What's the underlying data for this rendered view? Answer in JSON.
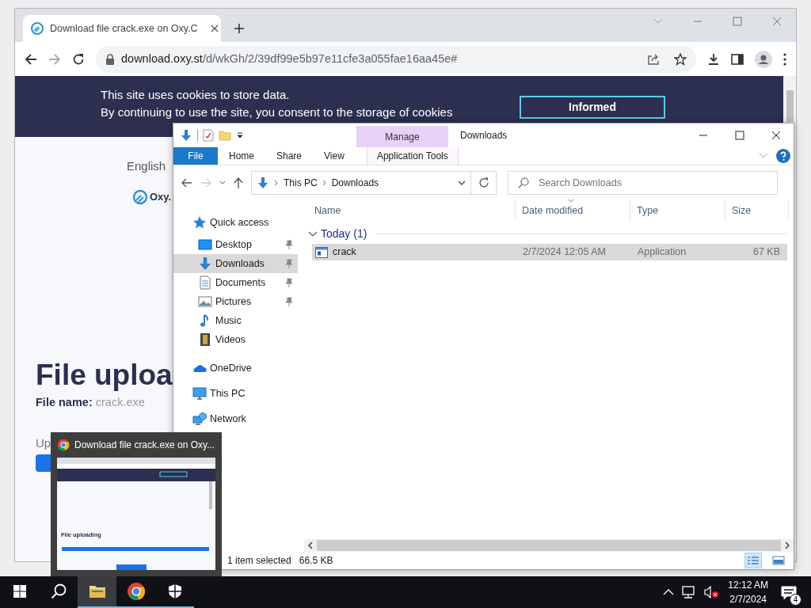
{
  "browser": {
    "tab": {
      "title": "Download file crack.exe on Oxy.C",
      "selected": true
    },
    "url": {
      "host": "download.oxy.st",
      "path": "/d/wkGh/2/39df99e5b97e11cfe3a055fae16aa45e#"
    }
  },
  "page": {
    "cookie_banner": {
      "lines": [
        "This site uses cookies to store data.",
        "By continuing to use the site, you consent to the storage of cookies"
      ],
      "button": "Informed"
    },
    "language": "English",
    "logo": "Oxy.",
    "heading": "File uploa",
    "file_label": "File name:",
    "file_name": "crack.exe",
    "progress": {
      "label": "Up"
    }
  },
  "explorer": {
    "title": "Downloads",
    "context_tab": "Manage",
    "tabs": [
      {
        "label": "File",
        "kind": "file-menu",
        "selected": false
      },
      {
        "label": "Home",
        "kind": "tab",
        "selected": false
      },
      {
        "label": "Share",
        "kind": "tab",
        "selected": false
      },
      {
        "label": "View",
        "kind": "tab",
        "selected": false
      },
      {
        "label": "Application Tools",
        "kind": "context",
        "selected": false
      }
    ],
    "address": [
      "This PC",
      "Downloads"
    ],
    "search": {
      "placeholder": "Search Downloads"
    },
    "nav": [
      {
        "label": "Quick access",
        "kind": "quick-access",
        "selected": false,
        "children": [
          {
            "label": "Desktop",
            "kind": "desktop",
            "selected": false,
            "pinned": true
          },
          {
            "label": "Downloads",
            "kind": "downloads",
            "selected": true,
            "pinned": true
          },
          {
            "label": "Documents",
            "kind": "documents",
            "selected": false,
            "pinned": true
          },
          {
            "label": "Pictures",
            "kind": "pictures",
            "selected": false,
            "pinned": true
          },
          {
            "label": "Music",
            "kind": "music",
            "selected": false,
            "pinned": false
          },
          {
            "label": "Videos",
            "kind": "videos",
            "selected": false,
            "pinned": false
          }
        ]
      },
      {
        "label": "OneDrive",
        "kind": "onedrive",
        "selected": false
      },
      {
        "label": "This PC",
        "kind": "pc",
        "selected": false
      },
      {
        "label": "Network",
        "kind": "network",
        "selected": false
      }
    ],
    "columns": [
      {
        "label": "Name",
        "sorted": false
      },
      {
        "label": "Date modified",
        "sorted": true
      },
      {
        "label": "Type",
        "sorted": false
      },
      {
        "label": "Size",
        "sorted": false
      }
    ],
    "groups": [
      {
        "label": "Today (1)",
        "expanded": true,
        "rows": [
          {
            "name": "crack",
            "date": "2/7/2024 12:05 AM",
            "type": "Application",
            "size": "67 KB",
            "selected": true
          }
        ]
      }
    ],
    "status": {
      "count": "1 item selected",
      "size": "66.5 KB"
    },
    "views": [
      {
        "kind": "details",
        "selected": true
      },
      {
        "kind": "large-icons",
        "selected": false
      }
    ]
  },
  "thumbnail": {
    "title": "Download file crack.exe on Oxy...",
    "preview_heading": "File uploading"
  },
  "taskbar": {
    "apps": [
      {
        "kind": "explorer",
        "running": true,
        "active": true
      },
      {
        "kind": "chrome",
        "running": true,
        "active": false
      },
      {
        "kind": "shield",
        "running": true,
        "active": false
      }
    ],
    "time": "12:12 AM",
    "date": "2/7/2024",
    "notifications": "4"
  }
}
